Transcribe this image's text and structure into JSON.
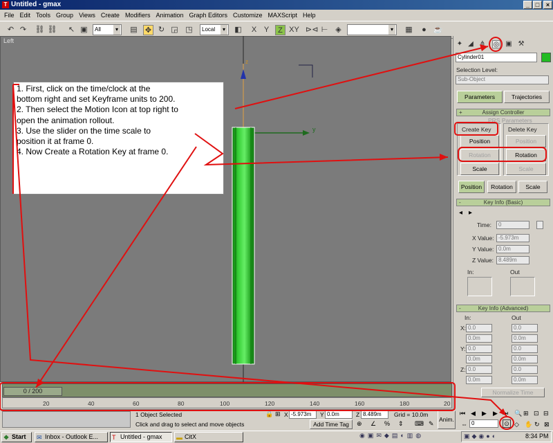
{
  "app": {
    "window_title": "Untitled - gmax"
  },
  "menu": [
    "File",
    "Edit",
    "Tools",
    "Group",
    "Views",
    "Create",
    "Modifiers",
    "Animation",
    "Graph Editors",
    "Customize",
    "MAXScript",
    "Help"
  ],
  "toolbar": {
    "selection_filter": "All",
    "coord_system": "Local"
  },
  "viewport": {
    "label": "Left",
    "axis_z": "z",
    "axis_y": "y"
  },
  "note": {
    "lines": [
      "1.  First, click on the time/clock at the",
      "bottom right and set Keyframe units to 200.",
      "2.  Then select the Motion Icon at top right to",
      "open the animation rollout.",
      "3.  Use the slider on the time scale to",
      "position it at frame 0.",
      "4.  Now Create a Rotation Key at frame 0."
    ]
  },
  "panel": {
    "object_name": "Cylinder01",
    "selection_level_label": "Selection Level:",
    "sub_object": "Sub-Object",
    "tabs": {
      "parameters": "Parameters",
      "trajectories": "Trajectories"
    },
    "assign_controller": "Assign Controller",
    "prs_params": "PRS Parameters",
    "create_key": "Create Key",
    "delete_key": "Delete Key",
    "position": "Position",
    "rotation": "Rotation",
    "scale": "Scale",
    "mode_position": "Position",
    "mode_rotation": "Rotation",
    "mode_scale": "Scale",
    "key_info_basic": "Key Info (Basic)",
    "time_label": "Time:",
    "time_value": "0",
    "x_label": "X Value:",
    "x_value": "-5.973m",
    "y_label": "Y Value:",
    "y_value": "0.0m",
    "z_label": "Z Value:",
    "z_value": "8.489m",
    "in_label": "In:",
    "out_label": "Out",
    "key_info_adv": "Key Info (Advanced)",
    "adv_in": "In:",
    "adv_out": "Out",
    "adv_x": "X:",
    "adv_y": "Y:",
    "adv_z": "Z:",
    "adv_vals": [
      "0.0",
      "0.0m",
      "0.0",
      "0.0m",
      "0.0",
      "0.0m"
    ],
    "normalize_time": "Normalize Time"
  },
  "timeline": {
    "slider_label": "0 / 200",
    "ticks": [
      "20",
      "40",
      "60",
      "80",
      "100",
      "120",
      "140",
      "160",
      "180",
      "20"
    ]
  },
  "status": {
    "selected": "1 Object Selected",
    "prompt": "Click and drag to select and move objects",
    "x_label": "X",
    "x_value": "-5.973m",
    "y_label": "Y",
    "y_value": "0.0m",
    "z_label": "Z",
    "z_value": "8.489m",
    "grid": "Grid = 10.0m",
    "add_time_tag": "Add Time Tag",
    "anim": "Anim.",
    "frame": "0"
  },
  "taskbar": {
    "start": "Start",
    "tasks": [
      "Inbox - Outlook E...",
      "Untitled - gmax",
      "CitX"
    ],
    "clock": "8:34 PM"
  },
  "colors": {
    "annotation": "#e01010",
    "cylinder": "#22bb22",
    "title_bar": "#0a246a"
  }
}
